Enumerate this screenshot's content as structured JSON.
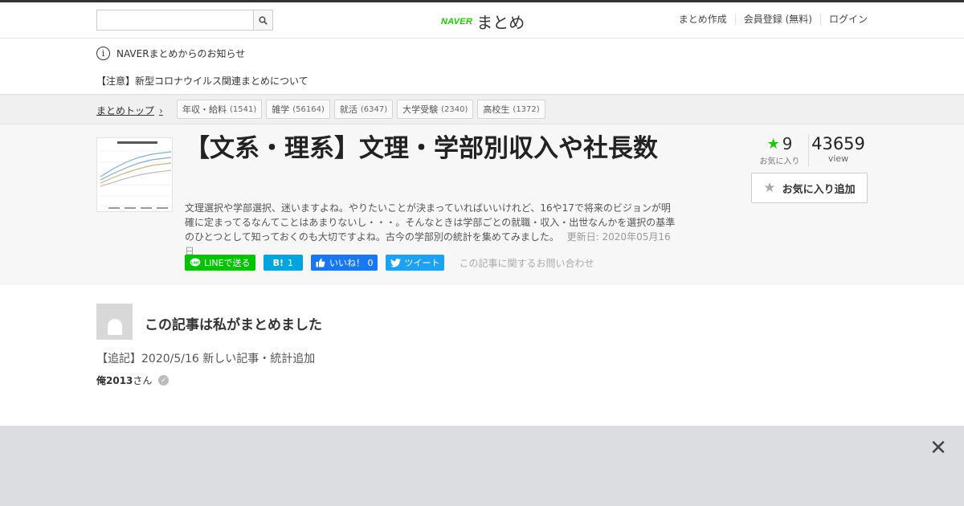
{
  "header": {
    "search_placeholder": "",
    "logo_brand": "NAVER",
    "logo_product": "まとめ",
    "links": [
      "まとめ作成",
      "会員登録 (無料)",
      "ログイン"
    ]
  },
  "notice": {
    "title": "NAVERまとめからのお知らせ",
    "item": "【注意】新型コロナウイルス関連まとめについて"
  },
  "breadcrumb": {
    "top": "まとめトップ",
    "tags": [
      {
        "label": "年収・給料",
        "count": "(1541)"
      },
      {
        "label": "雑学",
        "count": "(56164)"
      },
      {
        "label": "就活",
        "count": "(6347)"
      },
      {
        "label": "大学受験",
        "count": "(2340)"
      },
      {
        "label": "高校生",
        "count": "(1372)"
      }
    ]
  },
  "article": {
    "title": "【文系・理系】文理・学部別収入や社長数",
    "description": "文理選択や学部選択、迷いますよね。やりたいことが決まっていればいいけれど、16や17で将来のビジョンが明確に定まってるなんてことはあまりないし・・・。そんなときは学部ごとの就職・収入・出世なんかを選択の基準のひとつとして知っておくのも大切ですよね。古今の学部別の統計を集めてみました。",
    "updated": "更新日: 2020年05月16日",
    "favorites": "9",
    "favorites_label": "お気に入り",
    "views": "43659",
    "views_label": "view",
    "fav_button": "お気に入り追加",
    "share": {
      "line": "LINEで送る",
      "hatena_icon": "B!",
      "hatena_count": "1",
      "fb": "いいね！ 0",
      "tw": "ツイート"
    },
    "contact": "この記事に関するお問い合わせ"
  },
  "author": {
    "heading": "この記事は私がまとめました",
    "note": "【追記】2020/5/16 新しい記事・統計追加",
    "name": "俺2013",
    "suffix": "さん"
  },
  "colors": {
    "brand_green": "#1ec800",
    "line_green": "#00c300",
    "hatena_blue": "#00a4de",
    "fb_blue": "#1877f2",
    "tw_blue": "#1da1f2"
  }
}
